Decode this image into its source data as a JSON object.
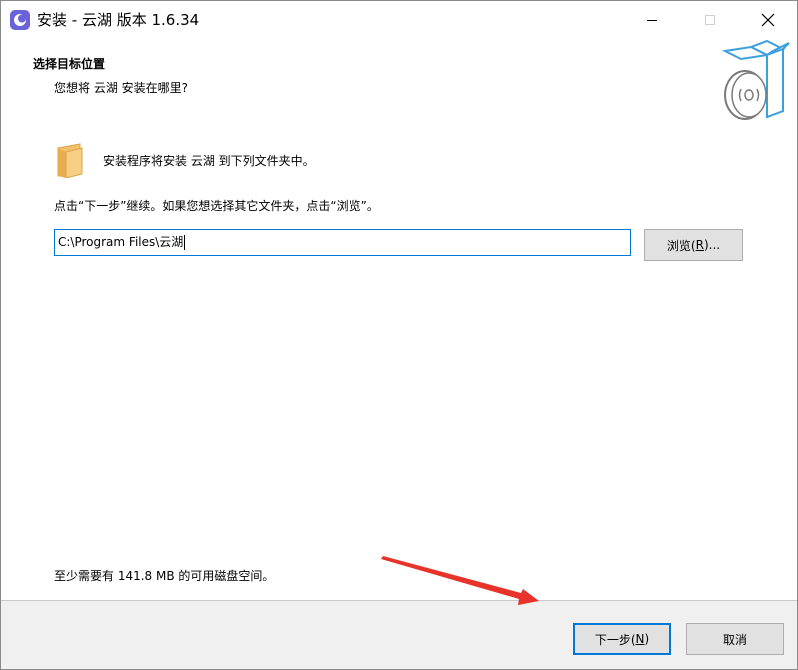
{
  "window": {
    "title": "安装 - 云湖 版本 1.6.34",
    "icons": {
      "app": "app-logo-icon",
      "minimize": "minimize-icon",
      "maximize": "maximize-icon",
      "close": "close-icon"
    }
  },
  "header": {
    "title": "选择目标位置",
    "subtitle": "您想将 云湖 安装在哪里?",
    "graphic_icon": "installer-box-disc-icon"
  },
  "content": {
    "folder_icon": "folder-icon",
    "install_line": "安装程序将安装 云湖 到下列文件夹中。",
    "hint_line": "点击“下一步”继续。如果您想选择其它文件夹，点击“浏览”。",
    "path_value": "C:\\Program Files\\云湖",
    "browse": {
      "label": "浏览(",
      "mnemonic": "R",
      "suffix": ")..."
    },
    "disk_space": "至少需要有 141.8 MB 的可用磁盘空间。"
  },
  "footer": {
    "next": {
      "label": "下一步(",
      "mnemonic": "N",
      "suffix": ")"
    },
    "cancel": {
      "label": "取消"
    }
  },
  "colors": {
    "accent": "#0078d7",
    "footer_bg": "#f0f0f0",
    "button_bg": "#e1e1e1",
    "annotation_arrow": "#e8332a",
    "folder": "#f5c26b"
  }
}
